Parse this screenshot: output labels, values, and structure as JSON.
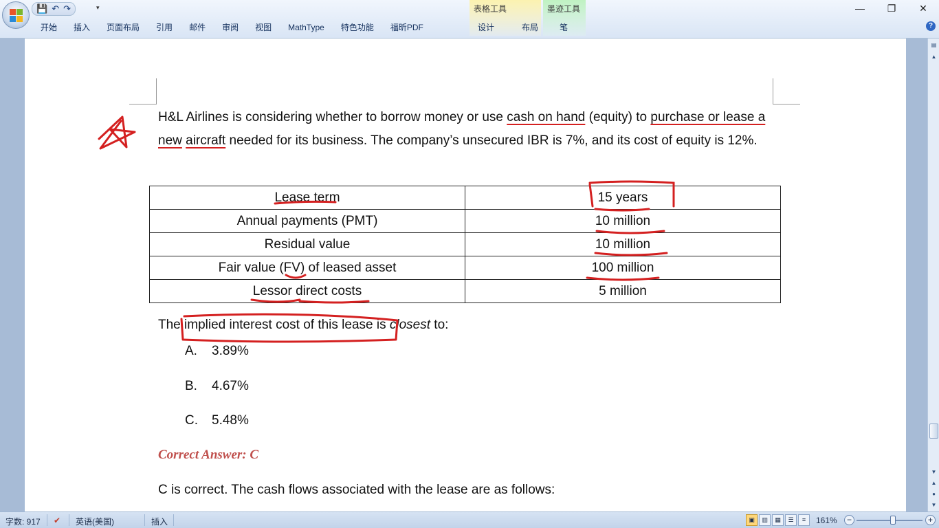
{
  "window": {
    "minimize_glyph": "—",
    "maximize_glyph": "❐",
    "close_glyph": "✕",
    "help_glyph": "?"
  },
  "qat": {
    "save_glyph": "💾",
    "undo_glyph": "↶",
    "redo_glyph": "↷",
    "more_glyph": "▾"
  },
  "tabs": [
    "开始",
    "插入",
    "页面布局",
    "引用",
    "邮件",
    "审阅",
    "视图",
    "MathType",
    "特色功能",
    "福昕PDF"
  ],
  "context_table": {
    "title": "表格工具",
    "tabs": [
      "设计",
      "布局"
    ]
  },
  "context_ink": {
    "title": "墨迹工具",
    "tabs": [
      "笔"
    ]
  },
  "document": {
    "intro_parts": [
      "H&L Airlines is considering whether to borrow money or use ",
      "cash on hand",
      " (equity) to ",
      "purchase or lease a new",
      " ",
      "aircraft",
      " needed for its business. The company’s unsecured IBR is 7%, and its cost of equity is 12%."
    ],
    "table": [
      [
        "Lease term",
        "15 years"
      ],
      [
        "Annual payments (PMT)",
        "10 million"
      ],
      [
        "Residual value",
        "10 million"
      ],
      [
        "Fair value (FV) of leased asset",
        "100 million"
      ],
      [
        "Lessor direct costs",
        "5 million"
      ]
    ],
    "question_pre": "The implied interest cost of this lease is ",
    "question_em": "closest",
    "question_post": " to:",
    "options": [
      {
        "label": "A.",
        "value": "3.89%"
      },
      {
        "label": "B.",
        "value": "4.67%"
      },
      {
        "label": "C.",
        "value": "5.48%"
      }
    ],
    "answer": "Correct Answer: C",
    "explanation": "C is correct. The cash flows associated with the lease are as follows:"
  },
  "ink_color": "#d42020",
  "status": {
    "word_count": "字数: 917",
    "language": "英语(美国)",
    "mode": "插入",
    "zoom": "161%",
    "zoom_minus": "−",
    "zoom_plus": "+"
  }
}
